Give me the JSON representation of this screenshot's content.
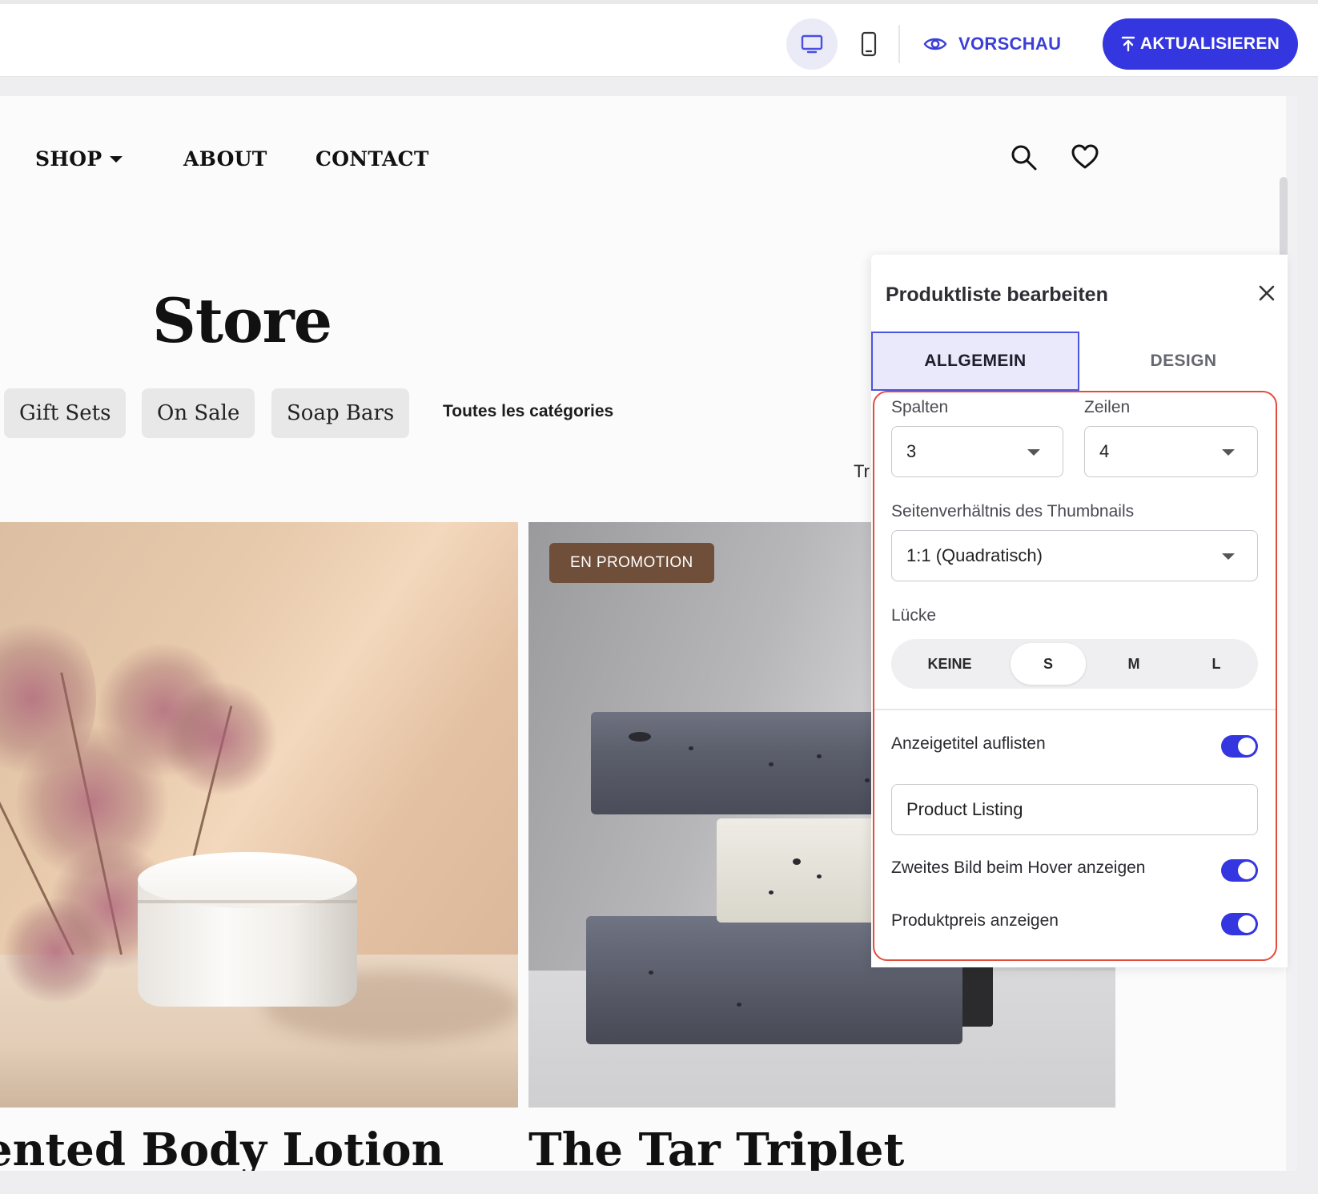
{
  "topbar": {
    "preview_label": "VORSCHAU",
    "update_label": "AKTUALISIEREN",
    "accent_color": "#3436e0"
  },
  "site": {
    "nav": {
      "shop": "SHOP",
      "about": "ABOUT",
      "contact": "CONTACT"
    },
    "page_title": "Store",
    "categories": [
      "Gift Sets",
      "On Sale",
      "Soap Bars"
    ],
    "all_categories": "Toutes les catégories",
    "sort_peek": "Tr",
    "products": [
      {
        "name": "ented Body Lotion"
      },
      {
        "name": "The Tar Triplet",
        "badge": "EN PROMOTION"
      }
    ]
  },
  "panel": {
    "title": "Produktliste bearbeiten",
    "tabs": {
      "general": "ALLGEMEIN",
      "design": "DESIGN"
    },
    "columns": {
      "label": "Spalten",
      "value": "3"
    },
    "rows": {
      "label": "Zeilen",
      "value": "4"
    },
    "aspect": {
      "label": "Seitenverhältnis des Thumbnails",
      "value": "1:1 (Quadratisch)"
    },
    "gap": {
      "label": "Lücke",
      "options": [
        "KEINE",
        "S",
        "M",
        "L"
      ],
      "selected": "S"
    },
    "toggles": {
      "show_title": {
        "label": "Anzeigetitel auflisten",
        "on": true
      },
      "title_value": "Product Listing",
      "hover_image": {
        "label": "Zweites Bild beim Hover anzeigen",
        "on": true
      },
      "show_price": {
        "label": "Produktpreis anzeigen",
        "on": true
      }
    },
    "highlight_color": "#e34b3b"
  }
}
